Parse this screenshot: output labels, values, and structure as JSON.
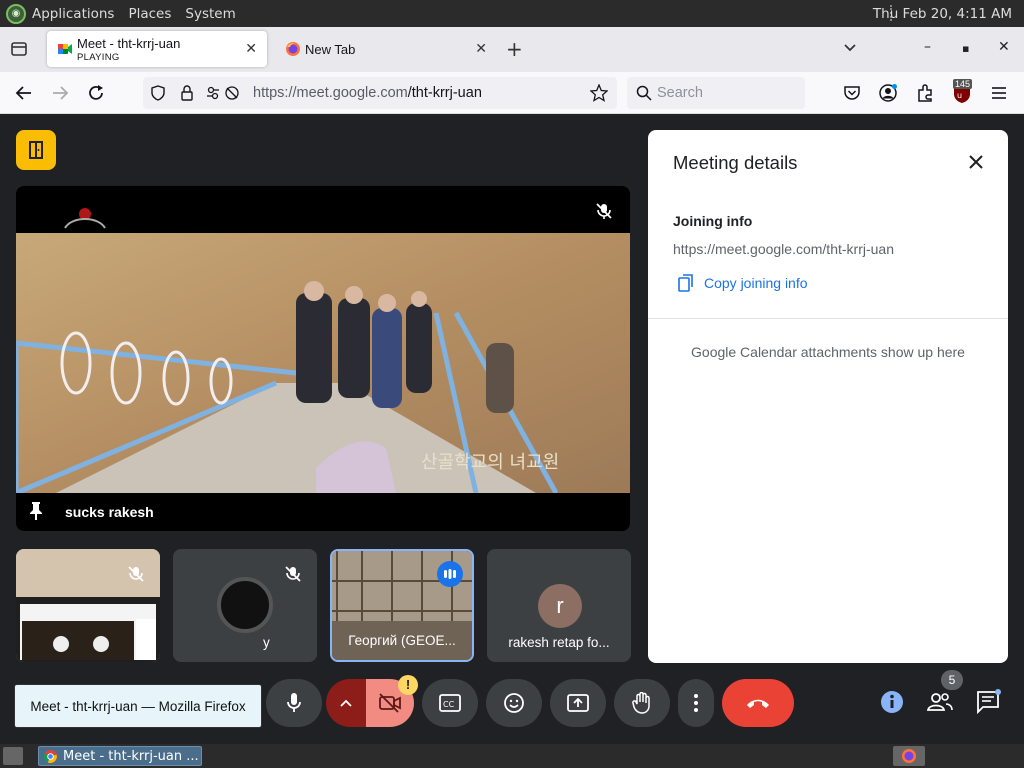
{
  "system_bar": {
    "menus": [
      "Applications",
      "Places",
      "System"
    ],
    "clock": "Thu Feb 20,  4:11 AM"
  },
  "browser": {
    "tabs": [
      {
        "title": "Meet - tht-krrj-uan",
        "status": "PLAYING",
        "active": true
      },
      {
        "title": "New Tab",
        "active": false
      }
    ],
    "url_host": "https://meet.google.com",
    "url_path": "/tht-krrj-uan",
    "search_placeholder": "Search",
    "extension_badge": "145"
  },
  "meet": {
    "main_tile": {
      "name": "sucks rakesh",
      "overlay_text": "산골학교의 녀교원"
    },
    "thumbnails": [
      {
        "label": ""
      },
      {
        "label": "y"
      },
      {
        "label": "Георгий (GEOE..."
      },
      {
        "label": "rakesh retap fo...",
        "avatar_letter": "r"
      }
    ],
    "details": {
      "title": "Meeting details",
      "joining_label": "Joining info",
      "joining_link": "https://meet.google.com/tht-krrj-uan",
      "copy_label": "Copy joining info",
      "calendar_note": "Google Calendar attachments show up here"
    },
    "participant_count": "5",
    "tooltip": "Meet - tht-krrj-uan — Mozilla Firefox"
  },
  "taskbar": {
    "window_title": "Meet - tht-krrj-uan ..."
  }
}
